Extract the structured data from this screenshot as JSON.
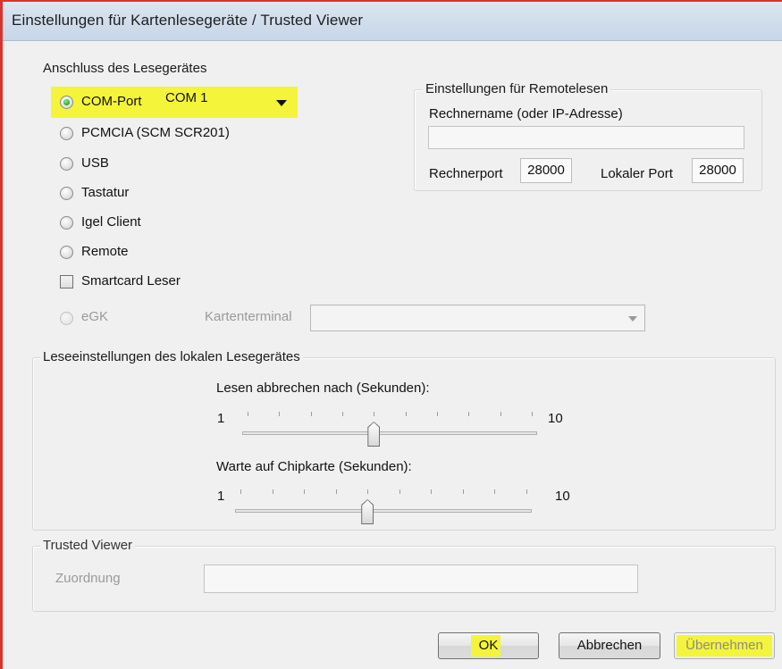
{
  "window": {
    "title": "Einstellungen für Kartenlesegeräte / Trusted Viewer"
  },
  "connection_group": {
    "legend": "Anschluss des Lesegerätes",
    "options": [
      {
        "label": "COM-Port",
        "selected": true
      },
      {
        "label": "PCMCIA (SCM SCR201)",
        "selected": false
      },
      {
        "label": "USB",
        "selected": false
      },
      {
        "label": "Tastatur",
        "selected": false
      },
      {
        "label": "Igel Client",
        "selected": false
      },
      {
        "label": "Remote",
        "selected": false
      }
    ],
    "com_port_value": "COM 1",
    "smartcard": {
      "label": "Smartcard Leser",
      "checked": false
    },
    "egk": {
      "label": "eGK",
      "enabled": false
    },
    "kartenterminal": {
      "label": "Kartenterminal",
      "value": ""
    }
  },
  "remote_group": {
    "legend": "Einstellungen für Remotelesen",
    "host_label": "Rechnername (oder IP-Adresse)",
    "host_value": "",
    "remote_port_label": "Rechnerport",
    "remote_port_value": "28000",
    "local_port_label": "Lokaler Port",
    "local_port_value": "28000"
  },
  "read_settings_group": {
    "legend": "Leseeinstellungen des lokalen Lesegerätes",
    "abort_slider": {
      "label": "Lesen abbrechen nach (Sekunden):",
      "min": "1",
      "max": "10",
      "value": 5
    },
    "wait_slider": {
      "label": "Warte auf Chipkarte (Sekunden):",
      "min": "1",
      "max": "10",
      "value": 5
    }
  },
  "trusted_viewer_group": {
    "legend": "Trusted Viewer",
    "assignment_label": "Zuordnung",
    "assignment_value": ""
  },
  "buttons": {
    "ok": "OK",
    "cancel": "Abbrechen",
    "apply": "Übernehmen"
  },
  "colors": {
    "highlight": "#f4f43a",
    "window_border": "#d9342b",
    "dialog_bg": "#f0f0f0"
  }
}
